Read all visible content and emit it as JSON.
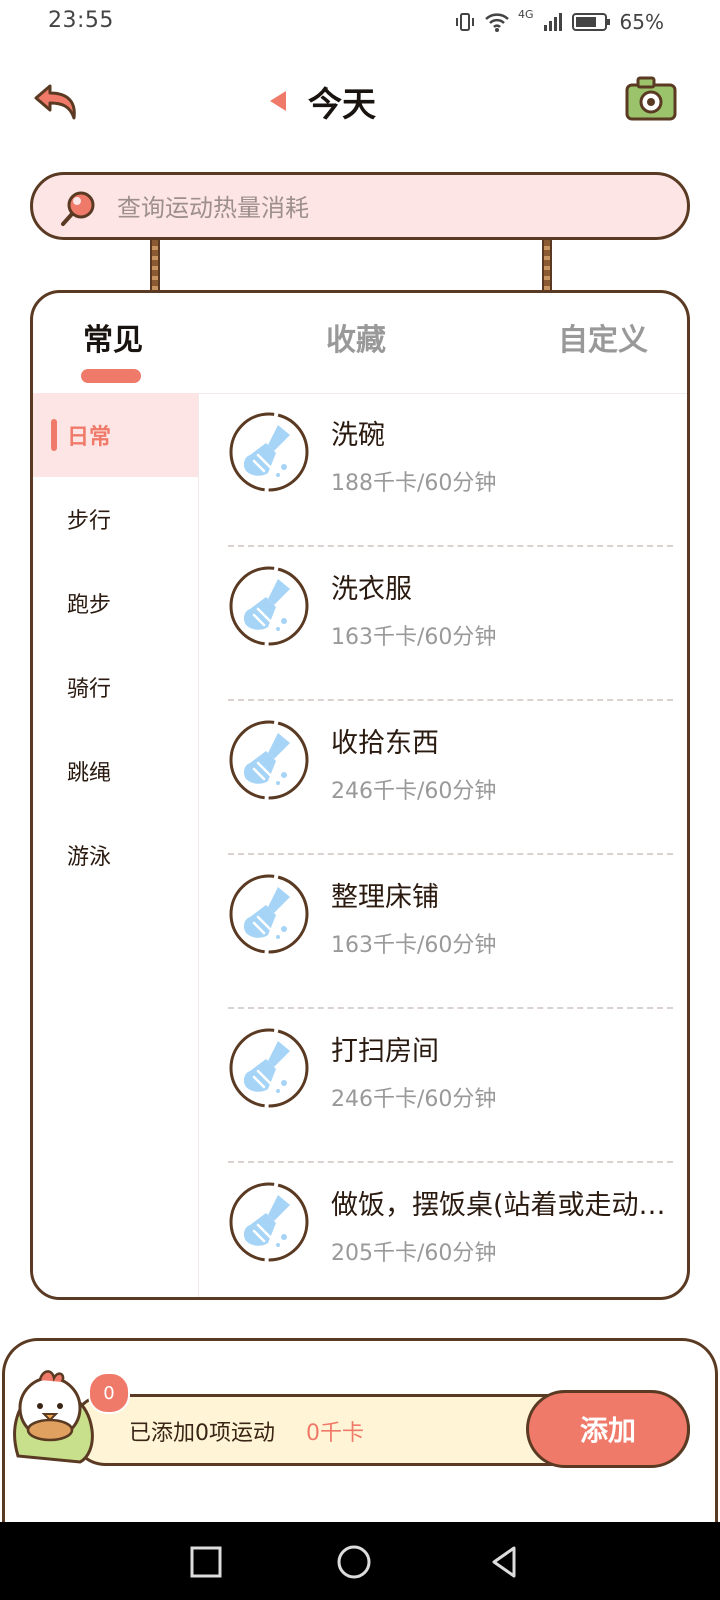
{
  "status_bar": {
    "time": "23:55",
    "network": "4G",
    "battery": "65%"
  },
  "header": {
    "title": "今天"
  },
  "search": {
    "placeholder": "查询运动热量消耗"
  },
  "tabs": [
    {
      "label": "常见"
    },
    {
      "label": "收藏"
    },
    {
      "label": "自定义"
    }
  ],
  "sidebar": {
    "items": [
      {
        "label": "日常"
      },
      {
        "label": "步行"
      },
      {
        "label": "跑步"
      },
      {
        "label": "骑行"
      },
      {
        "label": "跳绳"
      },
      {
        "label": "游泳"
      }
    ]
  },
  "activities": [
    {
      "name": "洗碗",
      "calories": "188千卡/60分钟"
    },
    {
      "name": "洗衣服",
      "calories": "163千卡/60分钟"
    },
    {
      "name": "收拾东西",
      "calories": "246千卡/60分钟"
    },
    {
      "name": "整理床铺",
      "calories": "163千卡/60分钟"
    },
    {
      "name": "打扫房间",
      "calories": "246千卡/60分钟"
    },
    {
      "name": "做饭，摆饭桌(站着或走动…",
      "calories": "205千卡/60分钟"
    }
  ],
  "summary": {
    "count_badge": "0",
    "added_text": "已添加0项运动",
    "added_kcal": "0千卡",
    "add_label": "添加"
  },
  "colors": {
    "accent": "#f07a6a",
    "outline": "#5a3a22",
    "search_bg": "#fde5e5",
    "bar_bg": "#fff5d6",
    "broom_icon": "#a6d4f7"
  }
}
